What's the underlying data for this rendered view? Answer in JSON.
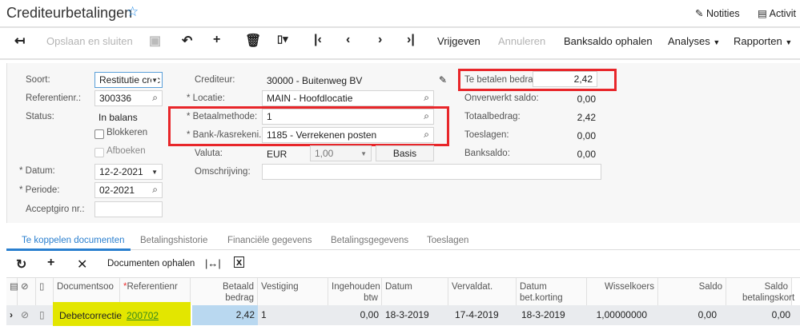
{
  "header": {
    "title": "Crediteurbetalingen",
    "notes": "Notities",
    "activities": "Activit"
  },
  "toolbar": {
    "save_close": "Opslaan en sluiten",
    "release": "Vrijgeven",
    "cancel": "Annuleren",
    "bank_balance": "Banksaldo ophalen",
    "analyses": "Analyses",
    "reports": "Rapporten"
  },
  "form": {
    "type_label": "Soort:",
    "type_value": "Restitutie crec",
    "ref_label": "Referentienr.:",
    "ref_value": "300336",
    "status_label": "Status:",
    "status_value": "In balans",
    "hold_label": "Blokkeren",
    "writeoff_label": "Afboeken",
    "date_label": "Datum:",
    "date_value": "12-2-2021",
    "period_label": "Periode:",
    "period_value": "02-2021",
    "giro_label": "Acceptgiro nr.:",
    "giro_value": "",
    "vendor_label": "Crediteur:",
    "vendor_value": "30000 - Buitenweg BV",
    "location_label": "Locatie:",
    "location_value": "MAIN - Hoofdlocatie",
    "method_label": "Betaalmethode:",
    "method_value": "1",
    "cash_label": "Bank-/kasrekeni...",
    "cash_value": "1185 - Verrekenen posten",
    "currency_label": "Valuta:",
    "currency_value": "EUR",
    "rate_value": "1,00",
    "base_button": "Basis",
    "desc_label": "Omschrijving:",
    "desc_value": "",
    "amount_label": "Te betalen bedrag:",
    "amount_value": "2,42",
    "unapplied_label": "Onverwerkt saldo:",
    "unapplied_value": "0,00",
    "total_label": "Totaalbedrag:",
    "total_value": "2,42",
    "charges_label": "Toeslagen:",
    "charges_value": "0,00",
    "bank_label": "Banksaldo:",
    "bank_value": "0,00"
  },
  "tabs": [
    "Te koppelen documenten",
    "Betalingshistorie",
    "Financiële gegevens",
    "Betalingsgegevens",
    "Toeslagen"
  ],
  "grid_toolbar": {
    "load_docs": "Documenten ophalen"
  },
  "grid": {
    "headers": [
      "Documentsoo",
      "Referentienr",
      "Betaald bedrag",
      "Vestiging",
      "Ingehouden btw",
      "Datum",
      "Vervaldat.",
      "Datum bet.korting",
      "Wisselkoers",
      "Saldo",
      "Saldo betalingskort"
    ],
    "rows": [
      [
        "Debetcorrectie",
        "200702",
        "2,42",
        "1",
        "0,00",
        "18-3-2019",
        "17-4-2019",
        "18-3-2019",
        "1,00000000",
        "0,00",
        "0,00"
      ]
    ]
  },
  "colors": {
    "accent": "#2a7fcf",
    "highlight": "#e3e600",
    "annotation": "#e8262a",
    "selected_cell": "#b9d8f0"
  }
}
